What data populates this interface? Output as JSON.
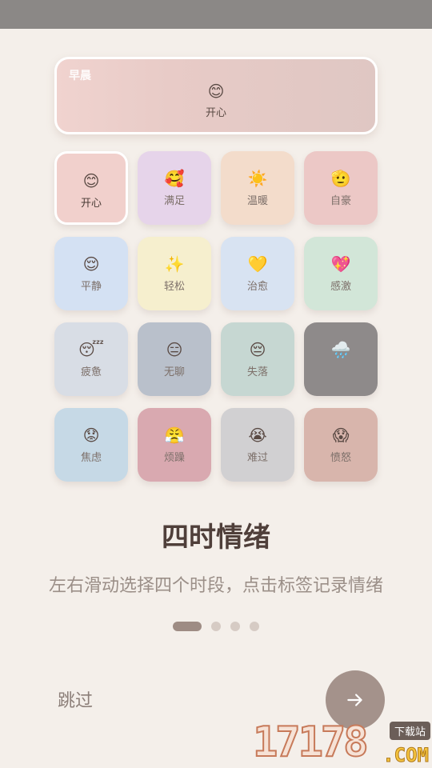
{
  "preview": {
    "period": "早晨",
    "emoji": "😊",
    "label": "开心",
    "bg": "#ecd0cc"
  },
  "moods": [
    {
      "emoji": "😊",
      "label": "开心",
      "bg": "#f1d0cc",
      "selected": true
    },
    {
      "emoji": "🥰",
      "label": "满足",
      "bg": "#e6d4ea"
    },
    {
      "emoji": "☀️",
      "label": "温暖",
      "bg": "#f3dccb"
    },
    {
      "emoji": "🫡",
      "label": "自豪",
      "bg": "#ecc8c6"
    },
    {
      "emoji": "😌",
      "label": "平静",
      "bg": "#d4e1f3"
    },
    {
      "emoji": "✨",
      "label": "轻松",
      "bg": "#f6efce"
    },
    {
      "emoji": "💛",
      "label": "治愈",
      "bg": "#d8e3f2"
    },
    {
      "emoji": "💖",
      "label": "感激",
      "bg": "#d2e6d8"
    },
    {
      "emoji": "😴",
      "label": "疲惫",
      "bg": "#d8dde5"
    },
    {
      "emoji": "😑",
      "label": "无聊",
      "bg": "#b9c0cb"
    },
    {
      "emoji": "😔",
      "label": "失落",
      "bg": "#c6d7d2"
    },
    {
      "emoji": "🌧️",
      "label": "",
      "bg": "#8e8a8a"
    },
    {
      "emoji": "😟",
      "label": "焦虑",
      "bg": "#c6d9e6"
    },
    {
      "emoji": "😤",
      "label": "烦躁",
      "bg": "#d9a9b0"
    },
    {
      "emoji": "😭",
      "label": "难过",
      "bg": "#d1d0d2"
    },
    {
      "emoji": "😱",
      "label": "愤怒",
      "bg": "#d8b5ac"
    }
  ],
  "title": "四时情绪",
  "description": "左右滑动选择四个时段，点击标签记录情绪",
  "pager": {
    "total": 4,
    "active": 0
  },
  "skip_label": "跳过",
  "next_icon": "arrow-right-icon",
  "watermark": {
    "number": "17178",
    "tag": "下载站",
    "domain": ".COM"
  }
}
